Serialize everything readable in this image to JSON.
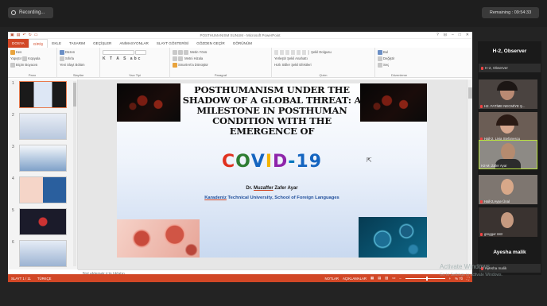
{
  "recording": {
    "label": "Recording...",
    "icon": "record-icon"
  },
  "remaining": {
    "label": "Remaining : 09:54:33"
  },
  "window": {
    "title": "POSTHUMANISM SUNUM - Microsoft PowerPoint",
    "controls": [
      "?",
      "⊟",
      "–",
      "□",
      "✕"
    ]
  },
  "ribbon_tabs": [
    "DOSYA",
    "GİRİŞ",
    "EKLE",
    "TASARIM",
    "GEÇİŞLER",
    "ANİMASYONLAR",
    "SLAYT GÖSTERİSİ",
    "GÖZDEN GEÇİR",
    "GÖRÜNÜM"
  ],
  "ribbon": {
    "pano": {
      "paste": "Yapıştır",
      "cut": "Kes",
      "copy": "Kopyala",
      "format": "Biçim Boyacısı",
      "label": "Pano"
    },
    "slaytlar": {
      "new_slide": "Yeni Slayt",
      "layout": "Düzen",
      "reset": "Sıfırla",
      "section": "Bölüm",
      "label": "Slaytlar"
    },
    "yazi_tipi": {
      "label": "Yazı Tipi"
    },
    "paragraf": {
      "text_dir": "Metin Yönü",
      "align": "Metni Hizala",
      "smartart": "SmartArt'a Dönüştür",
      "label": "Paragraf"
    },
    "cizim": {
      "arrange": "Yerleştir",
      "quick": "Hızlı Stiller",
      "fill": "Şekil Dolgusu",
      "outline": "Şekil Anahattı",
      "effects": "Şekil Efektleri",
      "label": "Çizim"
    },
    "duzenleme": {
      "find": "Bul",
      "replace": "Değiştir",
      "select": "Seç",
      "label": "Düzenleme"
    }
  },
  "thumbnails": [
    1,
    2,
    3,
    4,
    5,
    6
  ],
  "slide": {
    "title": "POSTHUMANISM UNDER THE SHADOW OF A GLOBAL THREAT: A MILESTONE IN POSTHUMAN CONDITION WITH THE EMERGENCE OF",
    "covid_letters": [
      {
        "ch": "C",
        "color": "#e0311f"
      },
      {
        "ch": "O",
        "color": "#2e7d32"
      },
      {
        "ch": "V",
        "color": "#1565c0"
      },
      {
        "ch": "I",
        "color": "#f4b400"
      },
      {
        "ch": "D",
        "color": "#8e24aa"
      },
      {
        "ch": "-",
        "color": "#0277bd"
      },
      {
        "ch": "1",
        "color": "#1565c0"
      },
      {
        "ch": "9",
        "color": "#1565c0"
      }
    ],
    "author_prefix": "Dr. ",
    "author_surname": "Muzaffer",
    "author_rest": " Zafer Ayar",
    "affil_a": "Karadeniz",
    "affil_b": " Technical University, School of Foreign Languages"
  },
  "notes_placeholder": "Not eklemek için tıklatın",
  "status": {
    "slide": "SLAYT 1 / 11",
    "lang": "TÜRKÇE",
    "notes": "NOTLAR",
    "comments": "AÇIKLAMALAR",
    "zoom": "% 70"
  },
  "panel": {
    "title": "H-2, Observer",
    "self_row": "H-2, Observer",
    "tiles": [
      {
        "name": "H2. FATİME NECMİYE Ş...",
        "skin": "#b98a73",
        "bg": "#4a4340"
      },
      {
        "name": "Hall-2, Livia Stefanescu",
        "skin": "#d7a78e",
        "bg": "#6b5d55"
      },
      {
        "name": "H2-M. Zafer Ayar",
        "skin": "#b58b6f",
        "bg": "#8d8a85"
      },
      {
        "name": "Hall-2,Ayşe Ünal",
        "skin": "#d8a889",
        "bg": "#7e7670"
      },
      {
        "name": "greggor östr",
        "skin": "#c69a80",
        "bg": "#3a3330"
      }
    ],
    "ayesha": "Ayesha malik",
    "ayesha_row": "Ayesha malik"
  },
  "watermark": {
    "line1": "Activate Windows",
    "line2": "Go to Settings to activate Windows."
  }
}
